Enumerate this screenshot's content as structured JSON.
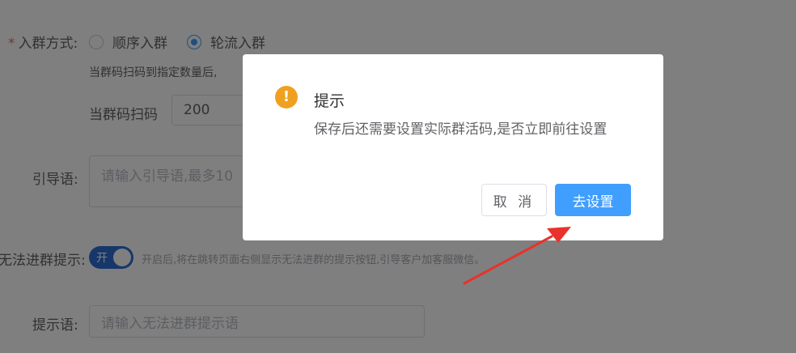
{
  "form": {
    "join_mode": {
      "label": "入群方式:",
      "options": [
        {
          "label": "顺序入群",
          "checked": false
        },
        {
          "label": "轮流入群",
          "checked": true
        }
      ],
      "hint": "当群码扫码到指定数量后,",
      "scan_label": "当群码扫码",
      "scan_value": "200"
    },
    "guide": {
      "label": "引导语:",
      "placeholder": "请输入引导语,最多10"
    },
    "cannot_join": {
      "label": "无法进群提示:",
      "switch_text": "开",
      "switch_on": true,
      "description": "开启后,将在跳转页面右侧显示无法进群的提示按钮,引导客户加客服微信。"
    },
    "tip": {
      "label": "提示语:",
      "placeholder": "请输入无法进群提示语"
    }
  },
  "dialog": {
    "icon": "warning-icon",
    "icon_glyph": "!",
    "title": "提示",
    "message": "保存后还需要设置实际群活码,是否立即前往设置",
    "cancel_label": "取 消",
    "confirm_label": "去设置"
  },
  "colors": {
    "primary": "#409eff",
    "warning": "#f0a020",
    "annotation_arrow": "#e8322b"
  }
}
